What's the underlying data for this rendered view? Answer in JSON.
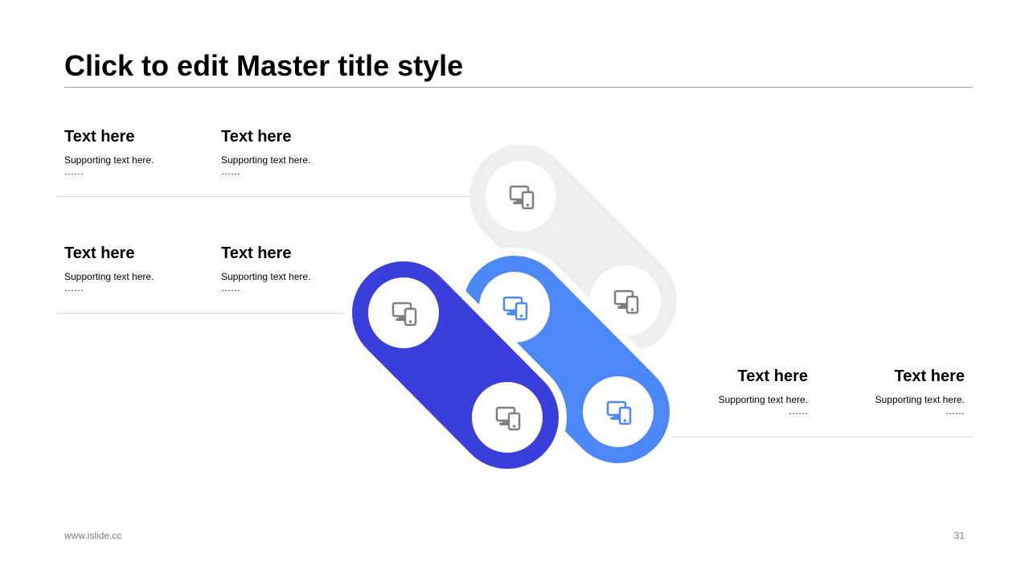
{
  "slide": {
    "title": "Click to edit Master title style",
    "footer_url": "www.islide.cc",
    "page_number": "31"
  },
  "items": [
    {
      "heading": "Text here",
      "body": "Supporting  text here.",
      "dots": "……"
    },
    {
      "heading": "Text here",
      "body": "Supporting  text here.",
      "dots": "……"
    },
    {
      "heading": "Text here",
      "body": "Supporting  text here.",
      "dots": "……"
    },
    {
      "heading": "Text here",
      "body": "Supporting  text here.",
      "dots": "……"
    },
    {
      "heading": "Text here",
      "body": "Supporting  text here.",
      "dots": "……"
    },
    {
      "heading": "Text here",
      "body": "Supporting  text here.",
      "dots": "……"
    }
  ],
  "graphic": {
    "icon": "devices-icon",
    "colors": {
      "gray_ring": "#efefef",
      "blue_ring": "#4d88f9",
      "indigo_ring": "#3a3fdc",
      "icon_gray": "#7f7f7f",
      "icon_blue": "#4d88f9"
    }
  }
}
